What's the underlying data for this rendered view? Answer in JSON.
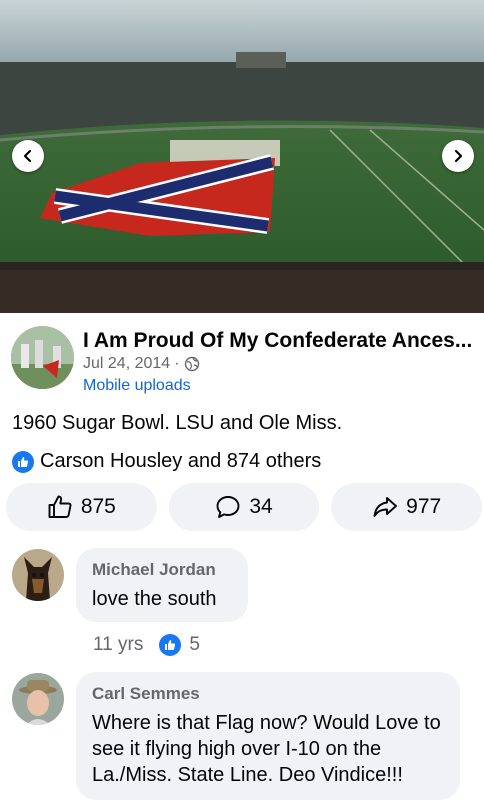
{
  "photo": {
    "alt_icons": {
      "prev": "chevron-left-icon",
      "next": "chevron-right-icon"
    }
  },
  "post": {
    "page_name": "I Am Proud Of My Confederate Ances...",
    "date": "Jul 24, 2014",
    "separator": "·",
    "privacy_icon": "globe-icon",
    "album": "Mobile uploads",
    "caption": "1960 Sugar Bowl. LSU and Ole Miss.",
    "reactions_text": "Carson Housley and 874 others",
    "actions": {
      "like_count": "875",
      "comment_count": "34",
      "share_count": "977"
    }
  },
  "comments": [
    {
      "author": "Michael Jordan",
      "text": "love the south",
      "time": "11 yrs",
      "likes": "5"
    },
    {
      "author": "Carl Semmes",
      "text": "Where is that Flag now? Would Love to see it flying high over I-10 on the La./Miss. State Line. Deo Vindice!!!"
    }
  ],
  "colors": {
    "accent": "#1877f2",
    "link": "#1565d8",
    "muted": "#65676b",
    "button_bg": "#f0f2f5"
  }
}
